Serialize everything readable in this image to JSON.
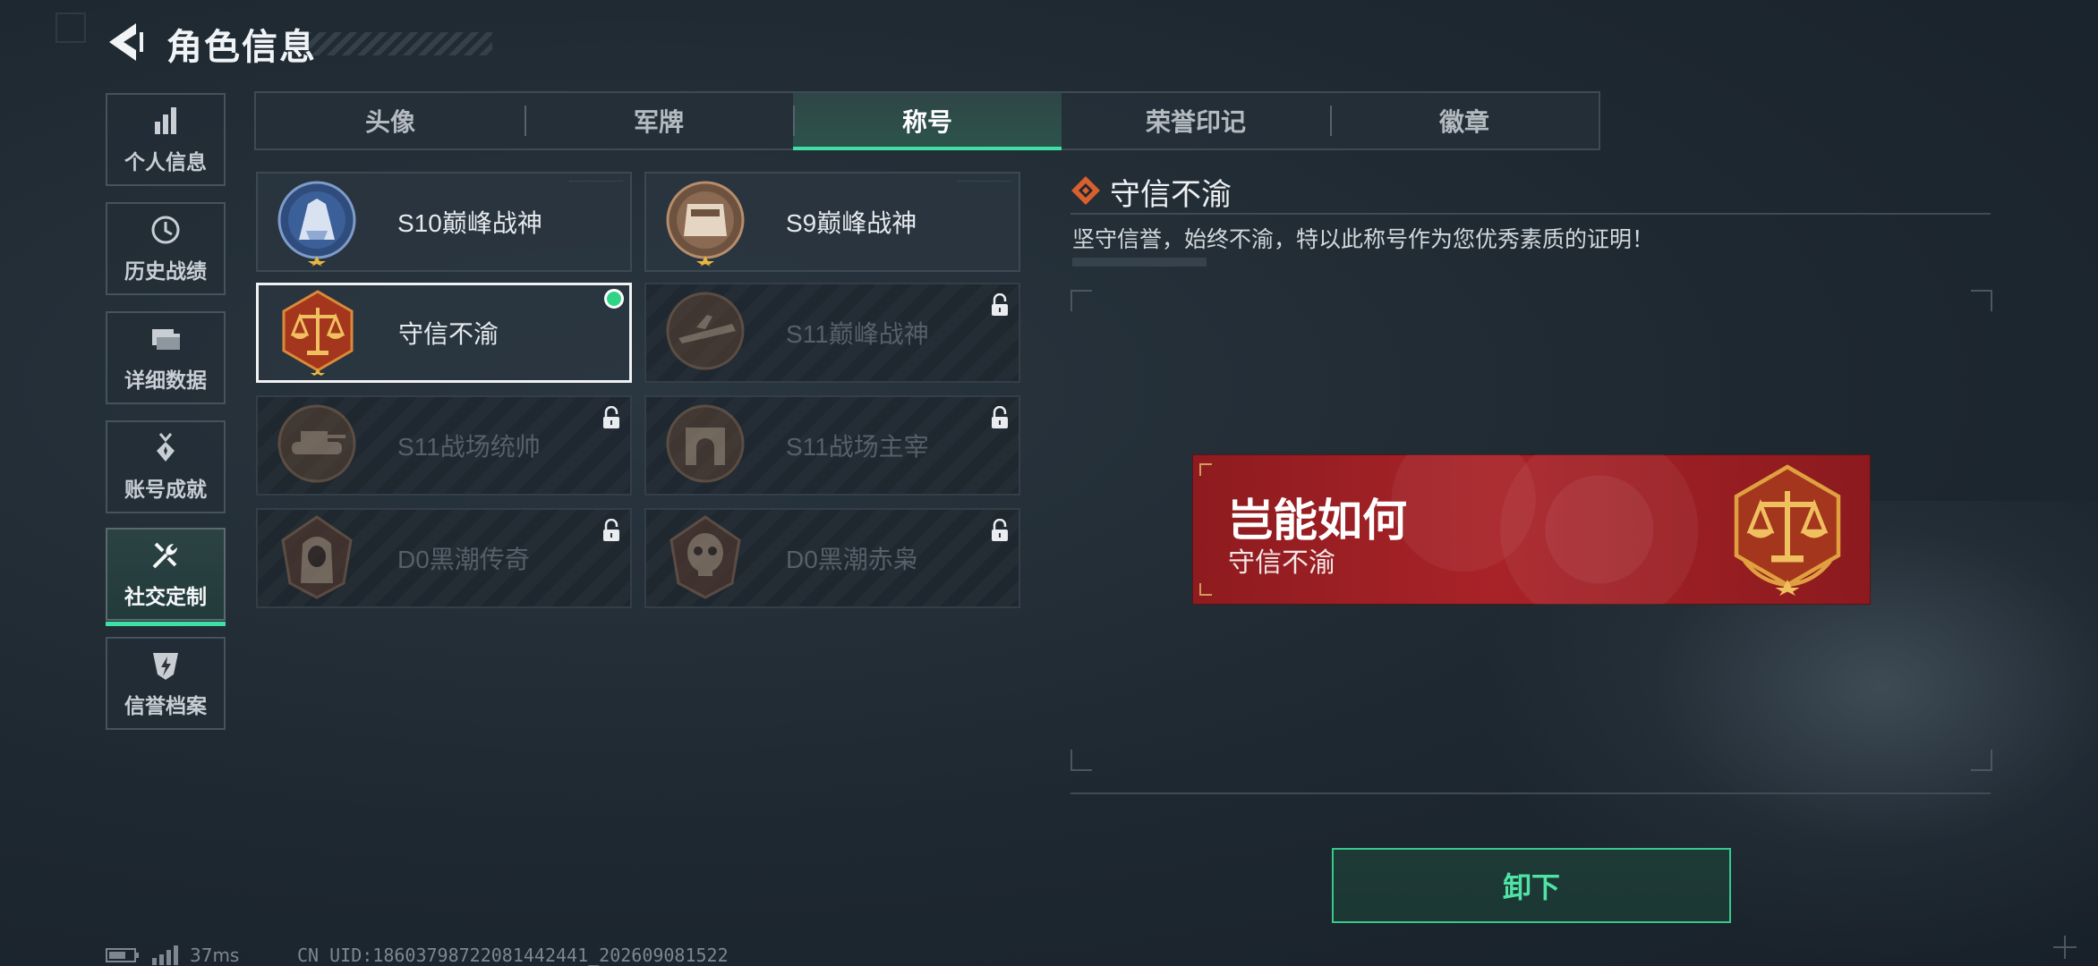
{
  "header": {
    "title": "角色信息"
  },
  "sidebar": {
    "items": [
      {
        "label": "个人信息",
        "icon": "bar-chart-icon"
      },
      {
        "label": "历史战绩",
        "icon": "clock-icon"
      },
      {
        "label": "详细数据",
        "icon": "folder-icon"
      },
      {
        "label": "账号成就",
        "icon": "medal-icon"
      },
      {
        "label": "社交定制",
        "icon": "tools-icon",
        "active": true
      },
      {
        "label": "信誉档案",
        "icon": "shield-bolt-icon"
      }
    ]
  },
  "tabs": [
    {
      "label": "头像"
    },
    {
      "label": "军牌"
    },
    {
      "label": "称号",
      "active": true
    },
    {
      "label": "荣誉印记"
    },
    {
      "label": "徽章"
    }
  ],
  "titles": [
    {
      "name": "S10巅峰战神",
      "locked": false,
      "emblem": "blue-wreath-emblem"
    },
    {
      "name": "S9巅峰战神",
      "locked": false,
      "emblem": "bronze-wreath-emblem"
    },
    {
      "name": "守信不渝",
      "locked": false,
      "selected": true,
      "equipped": true,
      "emblem": "scales-emblem"
    },
    {
      "name": "S11巅峰战神",
      "locked": true,
      "emblem": "plane-emblem"
    },
    {
      "name": "S11战场统帅",
      "locked": true,
      "emblem": "tank-emblem"
    },
    {
      "name": "S11战场主宰",
      "locked": true,
      "emblem": "arch-emblem"
    },
    {
      "name": "D0黑潮传奇",
      "locked": true,
      "emblem": "hooded-emblem"
    },
    {
      "name": "D0黑潮赤枭",
      "locked": true,
      "emblem": "skull-emblem"
    }
  ],
  "detail": {
    "title": "守信不渝",
    "description": "坚守信誉，始终不渝，特以此称号作为您优秀素质的证明！",
    "banner": {
      "headline": "岂能如何",
      "subtitle": "守信不渝"
    },
    "button_label": "卸下"
  },
  "status": {
    "ping": "37ms",
    "uid": "CN UID:18603798722081442441_202609081522"
  },
  "colors": {
    "accent": "#3fe0a5",
    "banner_red": "#a82328",
    "equipped_dot": "#2fd486"
  }
}
